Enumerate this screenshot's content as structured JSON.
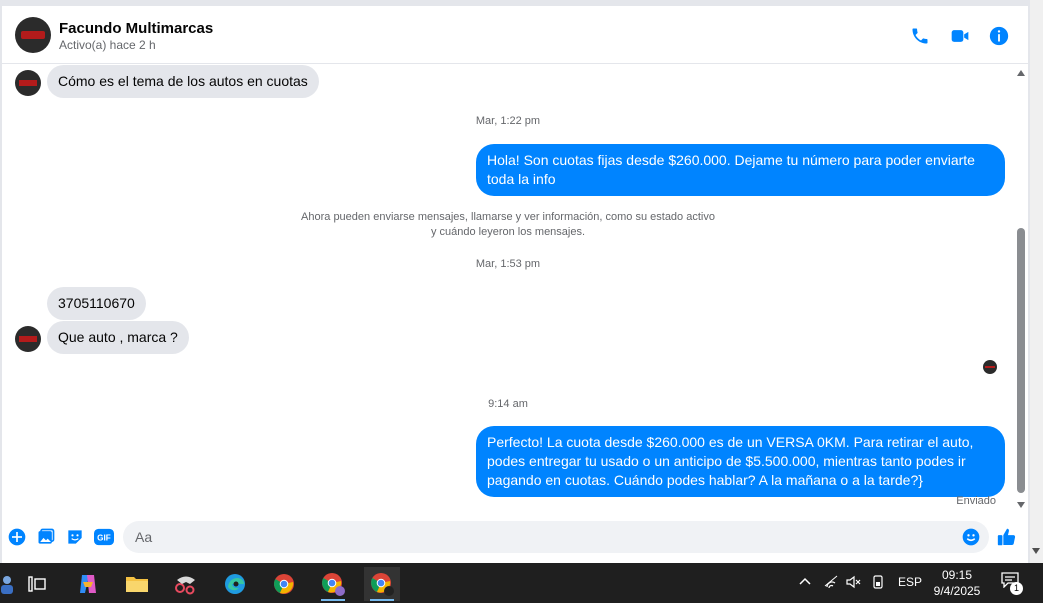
{
  "header": {
    "name": "Facundo Multimarcas",
    "status": "Activo(a) hace 2 h"
  },
  "messages": {
    "m1": "Cómo es el tema de los autos en cuotas",
    "ts1": "Mar, 1:22 pm",
    "m2": "Hola! Son cuotas fijas desde $260.000. Dejame tu número para poder enviarte toda la info",
    "notice_line1": "Ahora pueden enviarse mensajes, llamarse y ver información, como su estado activo",
    "notice_line2": "y cuándo leyeron los mensajes.",
    "ts2": "Mar, 1:53 pm",
    "m3": "3705110670",
    "m4": "Que auto , marca ?",
    "ts3": "9:14 am",
    "m5": "Perfecto! La cuota desde $260.000 es de un VERSA 0KM. Para retirar el auto, podes entregar tu usado o un anticipo de $5.500.000, mientras tanto podes ir pagando en cuotas. Cuándo podes hablar? A la mañana o a la tarde?}",
    "delivery_status": "Enviado"
  },
  "composer": {
    "placeholder": "Aa"
  },
  "taskbar": {
    "language": "ESP",
    "time": "09:15",
    "date": "9/4/2025",
    "notification_count": "1"
  },
  "colors": {
    "accent": "#0084ff",
    "incoming_bubble": "#e4e6eb"
  },
  "icons": [
    "phone-icon",
    "video-icon",
    "info-icon",
    "plus-icon",
    "image-icon",
    "sticker-icon",
    "gif-icon",
    "emoji-icon",
    "like-icon"
  ]
}
